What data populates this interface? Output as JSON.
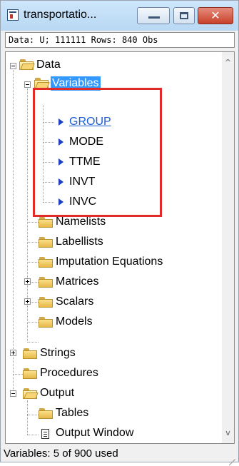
{
  "window": {
    "title": "transportatio...",
    "close_glyph": "✕",
    "info_text": "Data: U; 111111 Rows: 840 Obs"
  },
  "tree": {
    "data": "Data",
    "variables": "Variables",
    "vars": [
      "GROUP",
      "MODE",
      "TTME",
      "INVT",
      "INVC"
    ],
    "namelists": "Namelists",
    "labellists": "Labellists",
    "imputation": "Imputation Equations",
    "matrices": "Matrices",
    "scalars": "Scalars",
    "models": "Models",
    "strings": "Strings",
    "procedures": "Procedures",
    "output": "Output",
    "tables": "Tables",
    "output_window": "Output Window"
  },
  "scroll": {
    "up": "^",
    "down": "v"
  },
  "status": {
    "text": "Variables: 5 of 900 used"
  },
  "colors": {
    "highlight": "#e12b2b",
    "selection": "#3399ff",
    "link": "#1a5fd6",
    "arrow": "#1e3fbf"
  },
  "icons": [
    "app-icon",
    "minimize-icon",
    "maximize-icon",
    "close-icon",
    "folder-icon",
    "folder-open-icon",
    "document-icon",
    "triangle-right-icon",
    "expander-minus-icon",
    "expander-plus-icon"
  ]
}
